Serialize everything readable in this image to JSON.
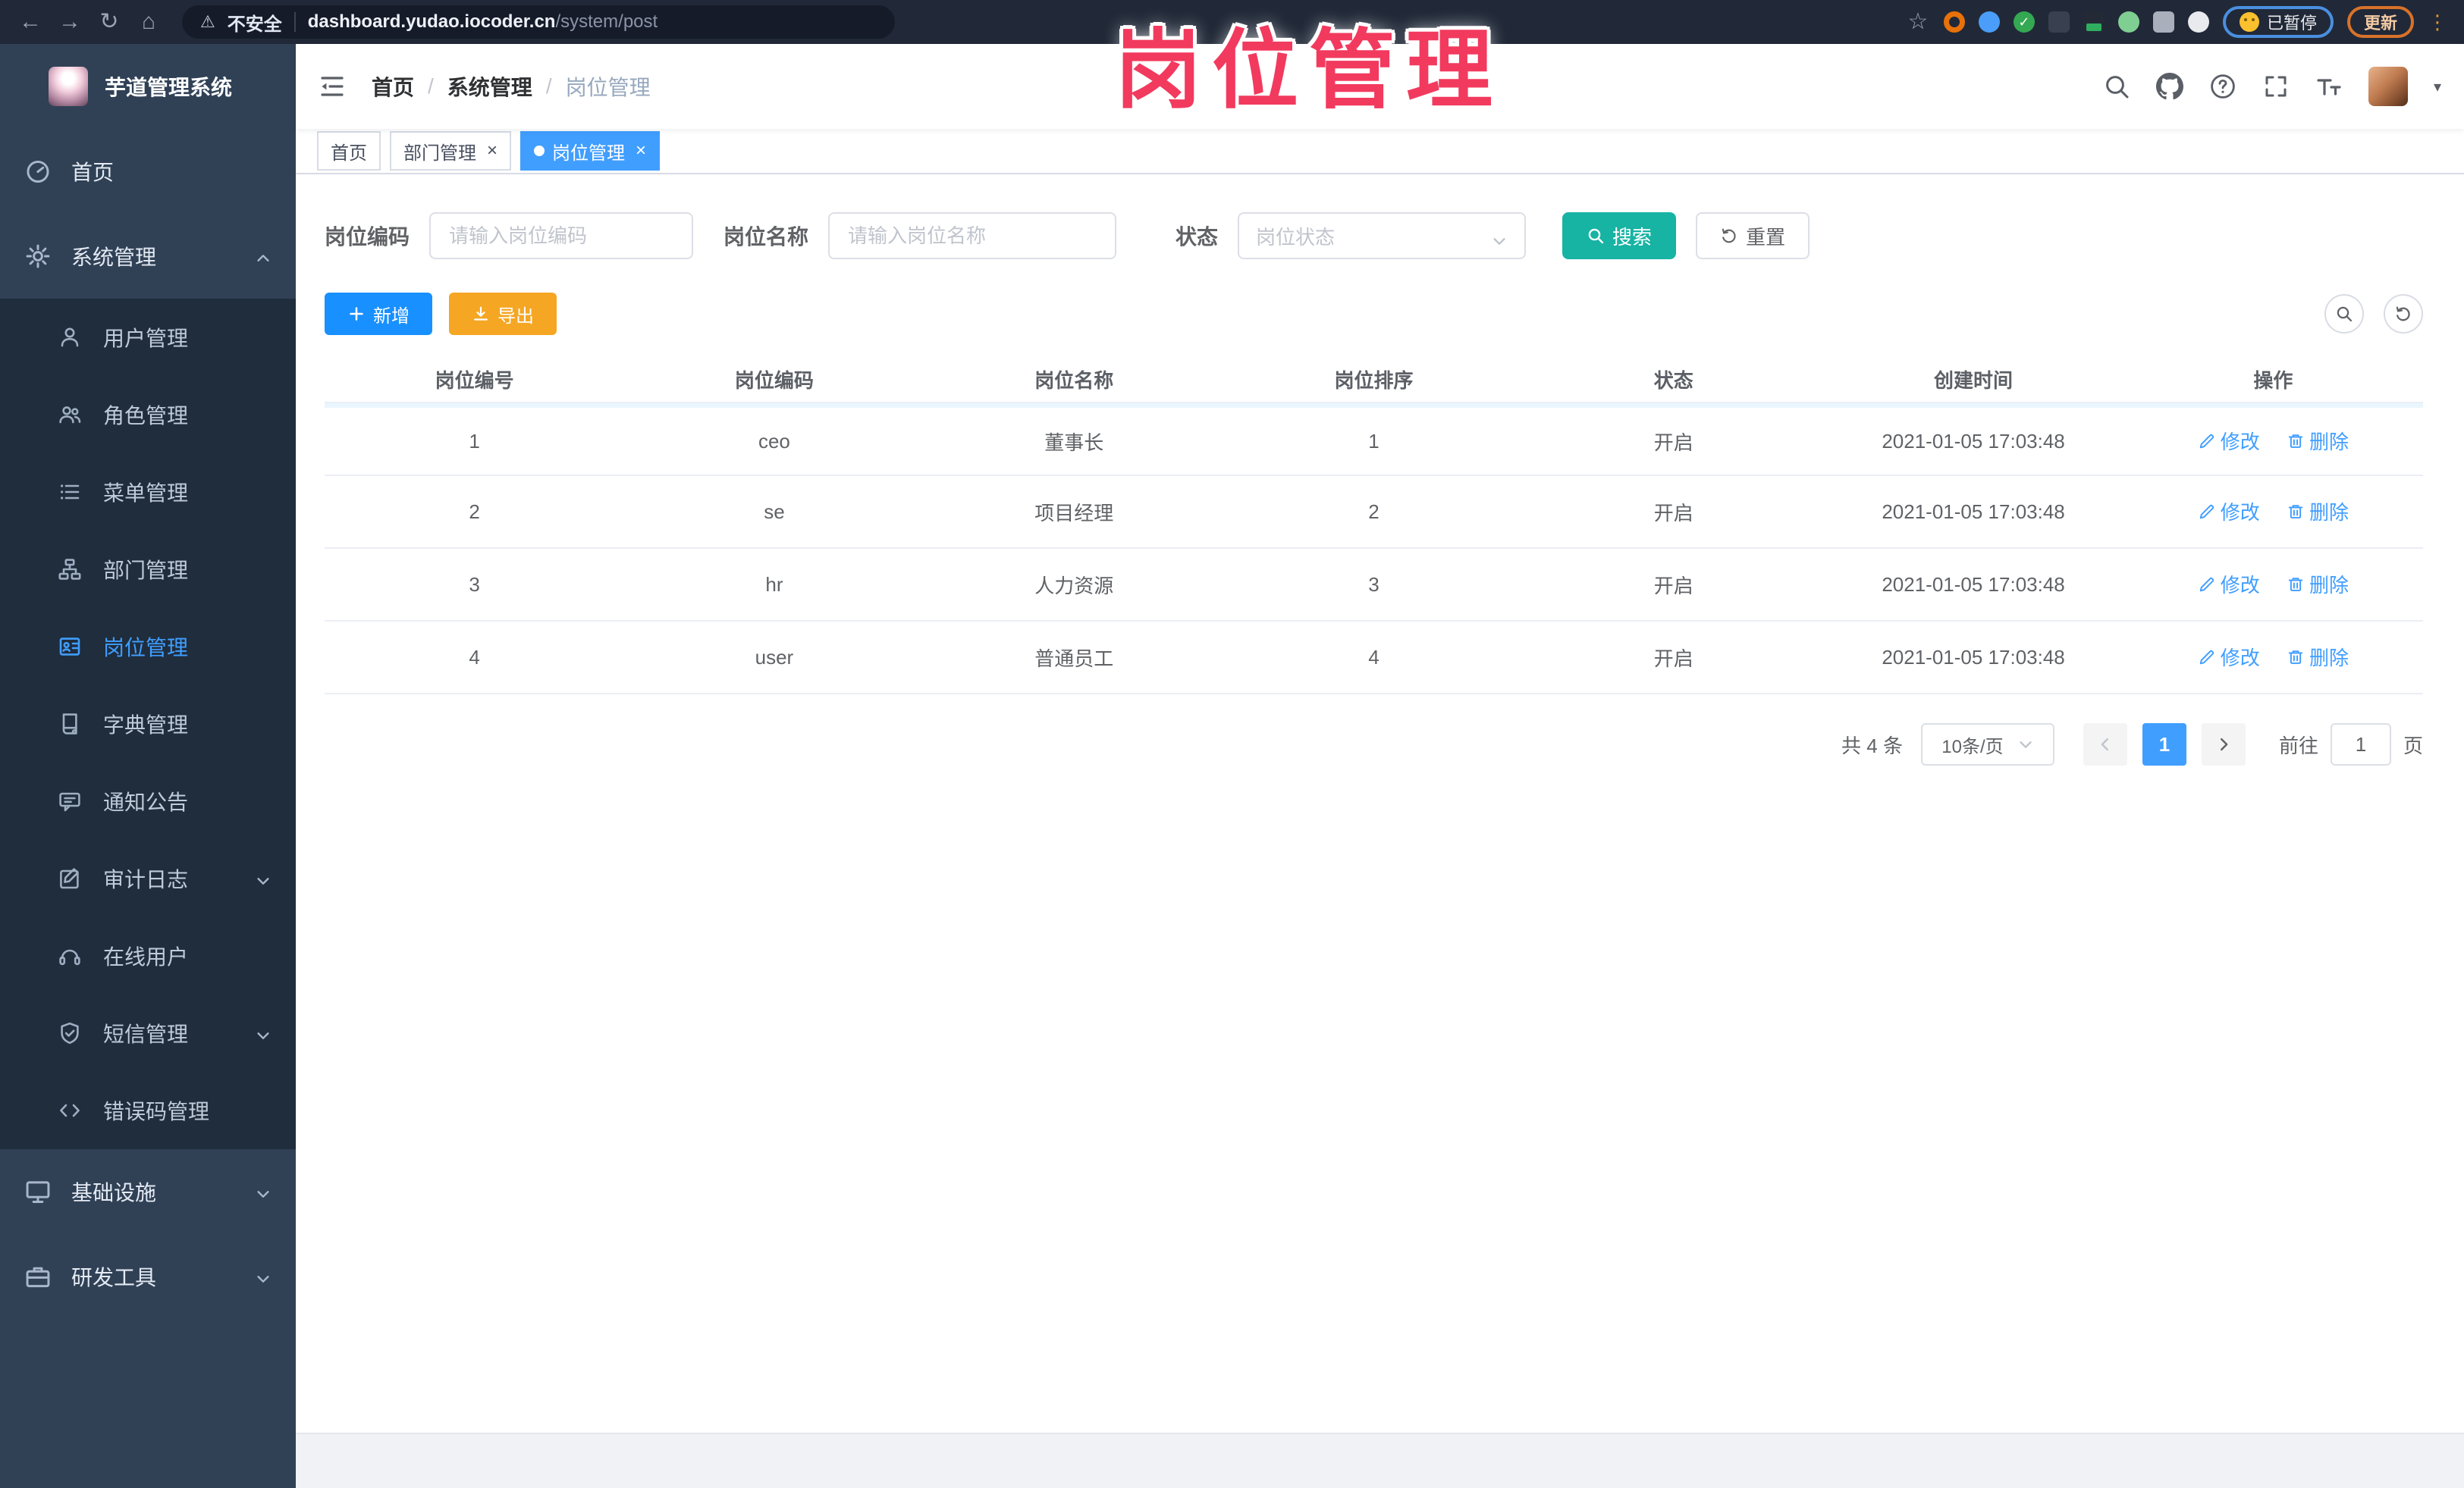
{
  "colors": {
    "primary": "#409eff",
    "button_blue": "#1890ff",
    "search_teal": "#17b3a3",
    "export_orange": "#f5a623",
    "annotation_pink": "#f23a5e",
    "sidebar_bg": "#304156",
    "submenu_bg": "#1f2d3d",
    "tab_active": "#409eff"
  },
  "glyphs": {
    "back": "←",
    "forward": "→",
    "reload": "↻",
    "home": "⌂",
    "warning": "⚠",
    "star": "☆",
    "kebab": "⋮",
    "caret_down": "▾",
    "close": "×",
    "slash": "/"
  },
  "browser": {
    "security_label": "不安全",
    "url_host": "dashboard.yudao.iocoder.cn",
    "url_path": "/system/post",
    "paused_badge": "已暂停",
    "update_button": "更新"
  },
  "annotation": "岗位管理",
  "sidebar": {
    "title": "芋道管理系统",
    "home": "首页",
    "system": "系统管理",
    "children": [
      "用户管理",
      "角色管理",
      "菜单管理",
      "部门管理",
      "岗位管理",
      "字典管理",
      "通知公告",
      "审计日志",
      "在线用户",
      "短信管理",
      "错误码管理"
    ],
    "infra": "基础设施",
    "devtools": "研发工具"
  },
  "header": {
    "breadcrumb": [
      "首页",
      "系统管理",
      "岗位管理"
    ]
  },
  "tabs": [
    {
      "label": "首页",
      "closable": false,
      "active": false
    },
    {
      "label": "部门管理",
      "closable": true,
      "active": false
    },
    {
      "label": "岗位管理",
      "closable": true,
      "active": true
    }
  ],
  "filters": {
    "code_label": "岗位编码",
    "code_placeholder": "请输入岗位编码",
    "name_label": "岗位名称",
    "name_placeholder": "请输入岗位名称",
    "status_label": "状态",
    "status_placeholder": "岗位状态",
    "search_label": "搜索",
    "reset_label": "重置"
  },
  "toolbar": {
    "add_label": "新增",
    "export_label": "导出"
  },
  "table": {
    "columns": [
      "岗位编号",
      "岗位编码",
      "岗位名称",
      "岗位排序",
      "状态",
      "创建时间",
      "操作"
    ],
    "rows": [
      {
        "id": "1",
        "code": "ceo",
        "name": "董事长",
        "sort": "1",
        "status": "开启",
        "created": "2021-01-05 17:03:48"
      },
      {
        "id": "2",
        "code": "se",
        "name": "项目经理",
        "sort": "2",
        "status": "开启",
        "created": "2021-01-05 17:03:48"
      },
      {
        "id": "3",
        "code": "hr",
        "name": "人力资源",
        "sort": "3",
        "status": "开启",
        "created": "2021-01-05 17:03:48"
      },
      {
        "id": "4",
        "code": "user",
        "name": "普通员工",
        "sort": "4",
        "status": "开启",
        "created": "2021-01-05 17:03:48"
      }
    ],
    "edit_label": "修改",
    "delete_label": "删除"
  },
  "pagination": {
    "total_text": "共 4 条",
    "page_size": "10条/页",
    "current_page": "1",
    "goto_label": "前往",
    "goto_value": "1",
    "page_unit": "页"
  }
}
